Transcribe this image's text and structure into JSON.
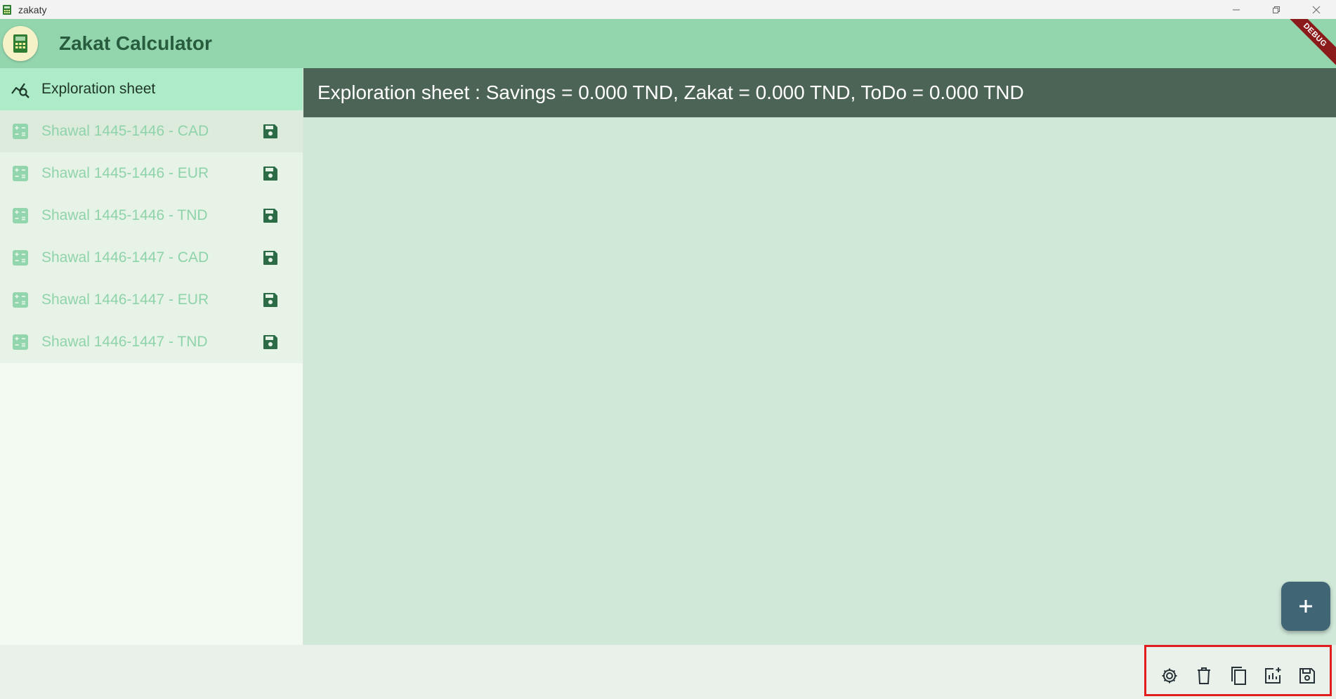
{
  "window": {
    "title": "zakaty",
    "minimize_icon": "minimize-icon",
    "restore_icon": "restore-icon",
    "close_icon": "close-icon"
  },
  "appbar": {
    "title": "Zakat Calculator",
    "logo_icon": "calculator-logo-icon",
    "debug_label": "DEBUG"
  },
  "sidebar": {
    "items": [
      {
        "label": "Exploration sheet",
        "icon": "chart-search-icon",
        "active": true
      },
      {
        "label": "Shawal 1445-1446 - CAD",
        "icon": "calculator-icon",
        "action_icon": "save-icon"
      },
      {
        "label": "Shawal 1445-1446 - EUR",
        "icon": "calculator-icon",
        "action_icon": "save-icon"
      },
      {
        "label": "Shawal 1445-1446 - TND",
        "icon": "calculator-icon",
        "action_icon": "save-icon"
      },
      {
        "label": "Shawal 1446-1447 - CAD",
        "icon": "calculator-icon",
        "action_icon": "save-icon"
      },
      {
        "label": "Shawal 1446-1447 - EUR",
        "icon": "calculator-icon",
        "action_icon": "save-icon"
      },
      {
        "label": "Shawal 1446-1447 - TND",
        "icon": "calculator-icon",
        "action_icon": "save-icon"
      }
    ]
  },
  "main": {
    "header": "Exploration sheet : Savings = 0.000 TND, Zakat = 0.000 TND, ToDo = 0.000 TND"
  },
  "fab": {
    "icon": "plus-icon"
  },
  "bottom_actions": [
    {
      "icon": "settings-icon"
    },
    {
      "icon": "delete-icon"
    },
    {
      "icon": "copy-icon"
    },
    {
      "icon": "add-chart-icon"
    },
    {
      "icon": "save-icon"
    }
  ],
  "colors": {
    "appbar": "#93d6ae",
    "header": "#4c6455",
    "main_bg": "#d0e8d8",
    "active_item": "#aeebc8",
    "fab": "#406575",
    "highlight_box": "#e01e1e"
  }
}
